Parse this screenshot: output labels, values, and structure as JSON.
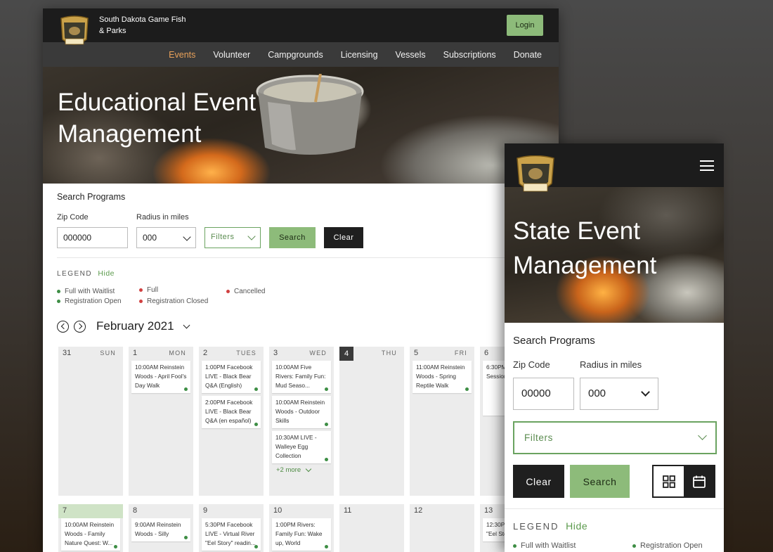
{
  "desktop": {
    "org_name": "South Dakota Game Fish & Parks",
    "login_label": "Login",
    "nav": [
      "Events",
      "Volunteer",
      "Campgrounds",
      "Licensing",
      "Vessels",
      "Subscriptions",
      "Donate"
    ],
    "hero_title": "Educational Event Management",
    "search": {
      "title": "Search Programs",
      "zip_label": "Zip Code",
      "zip_value": "000000",
      "radius_label": "Radius in miles",
      "radius_value": "000",
      "filters_label": "Filters",
      "search_label": "Search",
      "clear_label": "Clear"
    },
    "legend": {
      "title": "LEGEND",
      "hide": "Hide",
      "items": [
        "Full with Waitlist",
        "Full",
        "Cancelled",
        "Registration Open",
        "Registration Closed"
      ]
    },
    "month": "February 2021",
    "calendar": {
      "week1": [
        {
          "num": "31",
          "wd": "SUN",
          "events": []
        },
        {
          "num": "1",
          "wd": "MON",
          "events": [
            {
              "time": "10:00AM",
              "text": "Reinstein Woods - April Fool's Day Walk"
            }
          ]
        },
        {
          "num": "2",
          "wd": "TUES",
          "events": [
            {
              "time": "1:00PM",
              "text": "Facebook LIVE - Black Bear Q&A (English)"
            },
            {
              "time": "2:00PM",
              "text": "Facebook LIVE - Black Bear Q&A (en español)"
            }
          ]
        },
        {
          "num": "3",
          "wd": "WED",
          "events": [
            {
              "time": "10:00AM",
              "text": "Five Rivers: Family Fun: Mud Seaso..."
            },
            {
              "time": "10:00AM",
              "text": "Reinstein Woods - Outdoor Skills"
            },
            {
              "time": "10:30AM",
              "text": "LIVE - Walleye Egg Collection"
            }
          ],
          "more": "+2 more"
        },
        {
          "num": "4",
          "wd": "THU",
          "events": []
        },
        {
          "num": "5",
          "wd": "FRI",
          "events": [
            {
              "time": "11:00AM",
              "text": "Reinstein Woods - Spring Reptile Walk"
            }
          ]
        },
        {
          "num": "6",
          "wd": "",
          "events": [
            {
              "time": "6:30PM",
              "text": "Public I Session Area"
            }
          ]
        }
      ],
      "week2": [
        {
          "num": "7",
          "events": [
            {
              "time": "10:00AM",
              "text": "Reinstein Woods - Family Nature Quest: W..."
            }
          ]
        },
        {
          "num": "8",
          "events": [
            {
              "time": "9:00AM",
              "text": "Reinstein Woods - Silly"
            }
          ]
        },
        {
          "num": "9",
          "events": [
            {
              "time": "5:30PM",
              "text": "Facebook LIVE - Virtual River \"Eel Story\" readin..."
            }
          ]
        },
        {
          "num": "10",
          "events": [
            {
              "time": "1:00PM",
              "text": "Rivers: Family Fun: Wake up, World"
            }
          ]
        },
        {
          "num": "11",
          "events": []
        },
        {
          "num": "12",
          "events": []
        },
        {
          "num": "13",
          "events": [
            {
              "time": "12:30P",
              "text": "LIVE - V \"Eel Sto"
            }
          ]
        }
      ]
    }
  },
  "mobile": {
    "hero_title": "State Event Management",
    "search": {
      "title": "Search Programs",
      "zip_label": "Zip Code",
      "zip_value": "00000",
      "radius_label": "Radius in miles",
      "radius_value": "000",
      "filters_label": "Filters",
      "clear_label": "Clear",
      "search_label": "Search"
    },
    "legend": {
      "title": "LEGEND",
      "hide": "Hide",
      "items": [
        "Full with Waitlist",
        "Registration Open"
      ]
    },
    "icons": [
      "menu-icon",
      "grid-view-icon",
      "calendar-view-icon"
    ]
  },
  "colors": {
    "accent_green": "#8dbb7a",
    "nav_active": "#e8a15a",
    "dark": "#1c1c1c",
    "status_green": "#3e8e45",
    "status_red": "#d04040"
  }
}
